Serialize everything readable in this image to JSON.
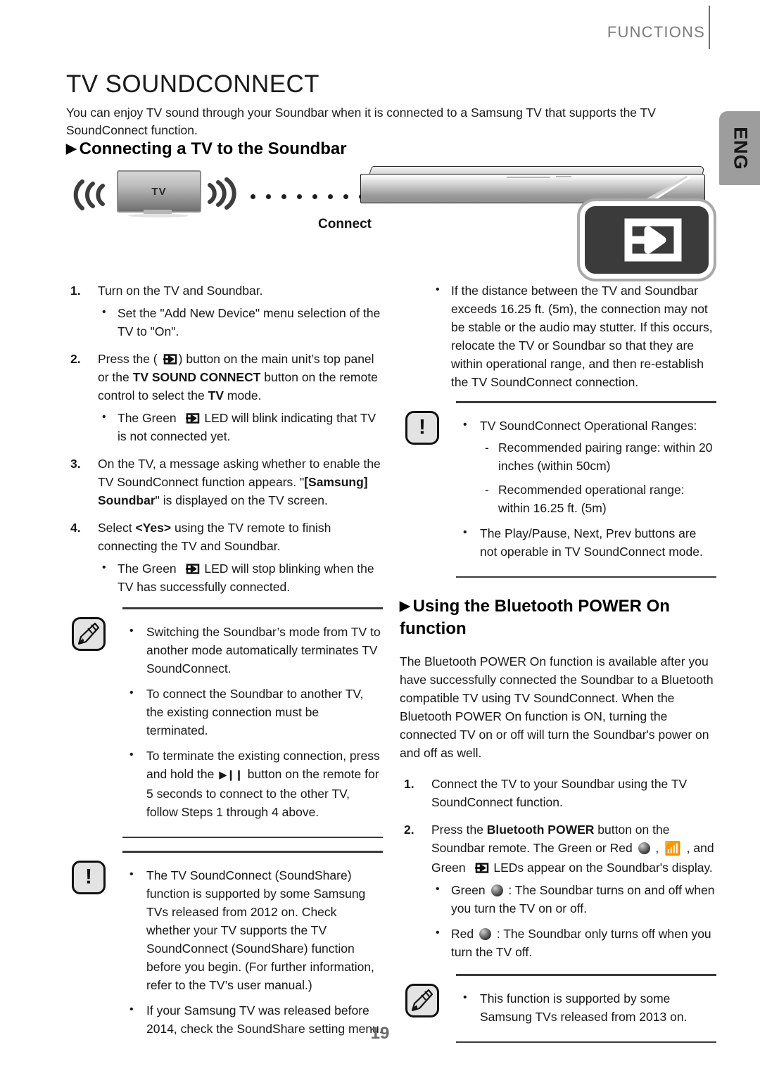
{
  "header": {
    "section_label": "FUNCTIONS",
    "language_tab": "ENG"
  },
  "title": "TV SOUNDCONNECT",
  "intro": "You can enjoy TV sound through your Soundbar when it is connected to a Samsung TV that supports the TV SoundConnect function.",
  "headings": {
    "connecting": "Connecting a TV to the Soundbar",
    "bluetooth_power": "Using the Bluetooth POWER On function"
  },
  "illustration": {
    "tv_label": "TV",
    "connect_label": "Connect",
    "source_icon_name": "tv-sound-connect-source-icon"
  },
  "left_column": {
    "steps": [
      {
        "num": "1.",
        "text": "Turn on the TV and Soundbar.",
        "bullets": [
          "Set the \"Add New Device\" menu selection of the TV to \"On\"."
        ]
      },
      {
        "num": "2.",
        "text_pre": "Press the (",
        "text_mid": ") button on the main unit’s top panel or the ",
        "bold1": "TV SOUND CONNECT",
        "text_post": " button on the remote control to select the ",
        "bold2": "TV",
        "text_end": " mode.",
        "bullet_pre": "The Green ",
        "bullet_post": " LED will blink indicating that TV is not connected yet."
      },
      {
        "num": "3.",
        "text_pre": "On the TV, a message asking whether to enable the TV SoundConnect function appears. \"",
        "bold": "[Samsung] Soundbar",
        "text_post": "\" is displayed on the TV screen."
      },
      {
        "num": "4.",
        "text_pre": "Select ",
        "bold": "<Yes>",
        "text_post": " using the TV remote to finish connecting the TV and Soundbar.",
        "bullet_pre": "The Green ",
        "bullet_post": " LED will stop blinking when the TV has successfully connected."
      }
    ],
    "note_box": {
      "icon": "note-pen-icon",
      "bullets": [
        "Switching the Soundbar’s mode from TV to another mode automatically terminates TV SoundConnect.",
        "To connect the Soundbar to another TV, the existing connection must be terminated."
      ],
      "bullet_play_pre": "To terminate the existing connection, press and hold the ",
      "bullet_play_post": " button on the remote for 5 seconds to connect to the other TV, follow Steps 1 through 4 above."
    },
    "caution_box": {
      "icon": "caution-exclamation-icon",
      "bullets": [
        "The TV SoundConnect (SoundShare) function is supported by some Samsung TVs released from 2012 on. Check whether your TV supports the TV SoundConnect (SoundShare) function before you begin. (For further information, refer to the TV’s user manual.)",
        "If your Samsung TV was released before 2014, check the SoundShare setting menu."
      ]
    }
  },
  "right_column": {
    "top_bullets": [
      "If the distance between the TV and Soundbar exceeds 16.25 ft. (5m), the connection may not be stable or the audio may stutter. If this occurs, relocate the TV or Soundbar so that they are within operational range, and then re-establish the TV SoundConnect connection."
    ],
    "caution_box": {
      "icon": "caution-exclamation-icon",
      "bullet_ranges_title": "TV SoundConnect Operational Ranges:",
      "ranges": [
        "Recommended pairing range: within 20 inches (within 50cm)",
        "Recommended operational range: within 16.25 ft. (5m)"
      ],
      "bullet_last": "The Play/Pause, Next, Prev buttons are not operable in TV SoundConnect mode."
    },
    "bluetooth_intro": "The Bluetooth POWER On function is available after you have successfully connected the Soundbar to a Bluetooth compatible TV using TV SoundConnect. When the Bluetooth POWER On function is ON, turning the connected TV on or off will turn the Soundbar's power on and off as well.",
    "steps": [
      {
        "num": "1.",
        "text": "Connect the TV to your Soundbar using the TV SoundConnect function."
      },
      {
        "num": "2.",
        "text_pre": "Press the ",
        "bold": "Bluetooth POWER",
        "text_mid": " button on the Soundbar remote. The Green or Red ",
        "text_mid2": " , ",
        "text_mid3": " , and Green ",
        "text_post": " LEDs appear on the Soundbar's display.",
        "bullets": [
          {
            "label": "Green ",
            "rest": " : The Soundbar turns on and off when you turn the TV on or off."
          },
          {
            "label": "Red ",
            "rest": " : The Soundbar only turns off when you turn the TV off."
          }
        ]
      }
    ],
    "note_box": {
      "icon": "note-pen-icon",
      "bullets": [
        "This function is supported by some Samsung TVs released from 2013 on."
      ]
    }
  },
  "page_number": "19",
  "colors": {
    "tab_bg": "#9d9d9d",
    "header_text": "#7c7c7c",
    "rule": "#3b3b3b",
    "callout_bg": "#3b3b3b"
  }
}
